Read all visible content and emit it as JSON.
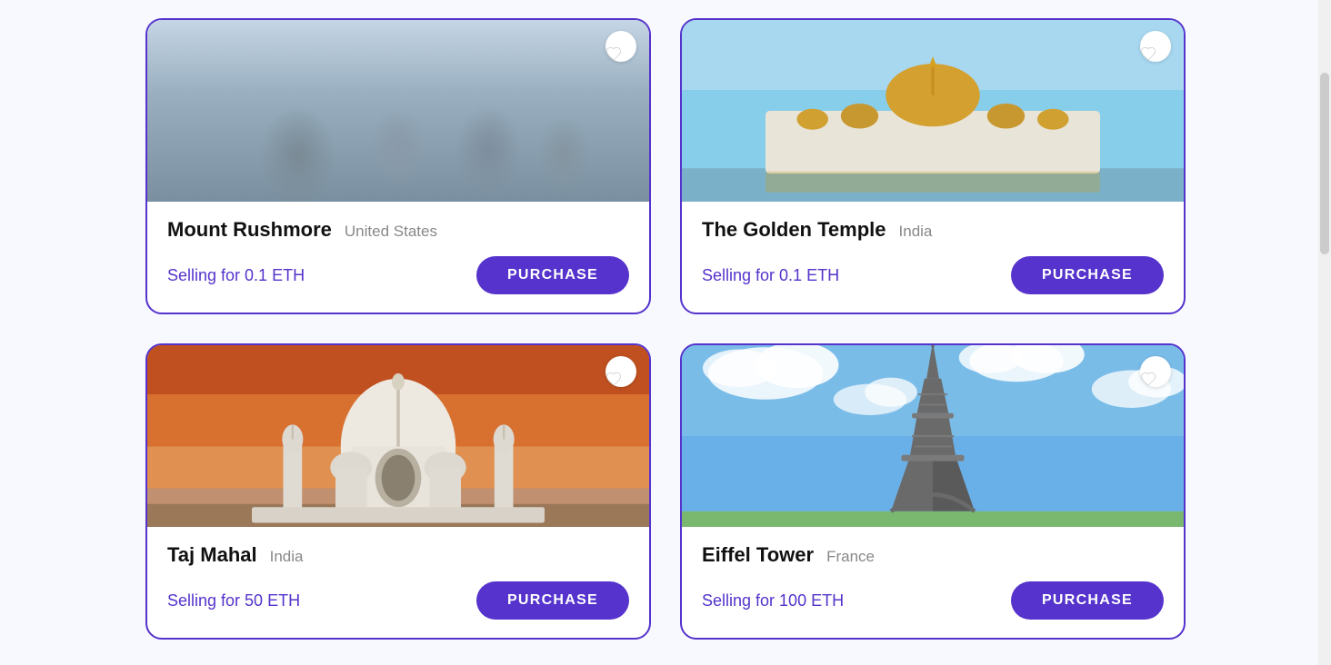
{
  "cards": [
    {
      "id": "mount-rushmore",
      "title": "Mount Rushmore",
      "location": "United States",
      "price": "Selling for 0.1 ETH",
      "purchase_label": "PURCHASE",
      "image_type": "rushmore"
    },
    {
      "id": "golden-temple",
      "title": "The Golden Temple",
      "location": "India",
      "price": "Selling for 0.1 ETH",
      "purchase_label": "PURCHASE",
      "image_type": "golden-temple"
    },
    {
      "id": "taj-mahal",
      "title": "Taj Mahal",
      "location": "India",
      "price": "Selling for 50 ETH",
      "purchase_label": "PURCHASE",
      "image_type": "taj-mahal"
    },
    {
      "id": "eiffel-tower",
      "title": "Eiffel Tower",
      "location": "France",
      "price": "Selling for 100 ETH",
      "purchase_label": "PURCHASE",
      "image_type": "eiffel"
    }
  ]
}
